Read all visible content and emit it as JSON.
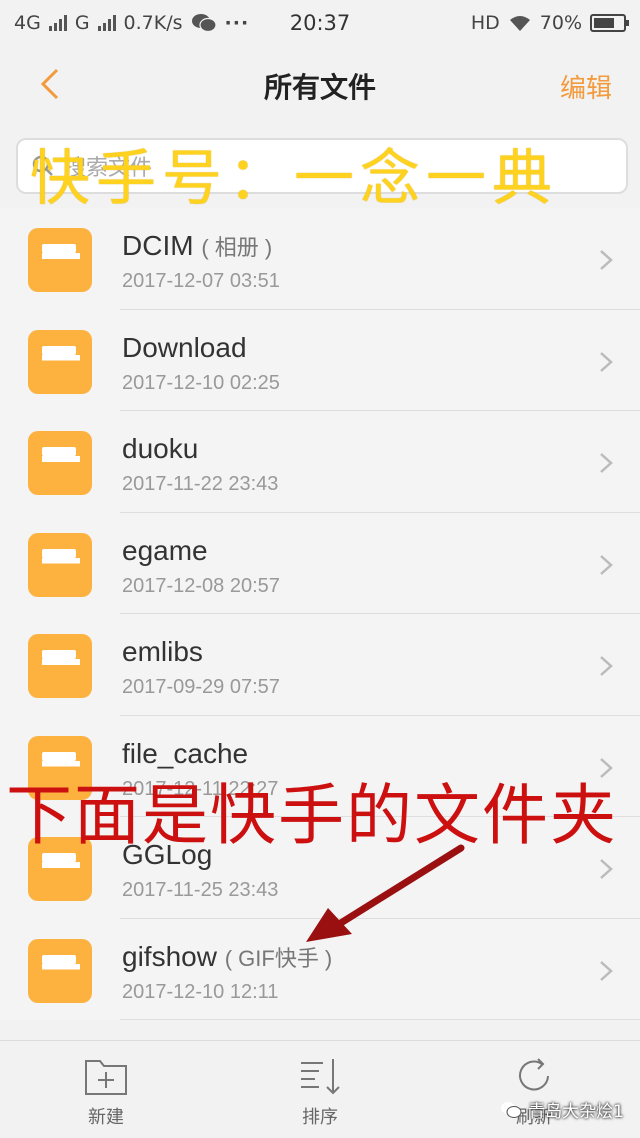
{
  "status_bar": {
    "network_1": "4G",
    "network_2": "G",
    "speed": "0.7K/s",
    "dots": "···",
    "time": "20:37",
    "hd": "HD",
    "battery": "70%",
    "battery_level_pct": 70
  },
  "nav": {
    "title": "所有文件",
    "edit_label": "编辑"
  },
  "search": {
    "placeholder": "搜索文件"
  },
  "overlays": {
    "top_text": "快手号：一念一典",
    "middle_text": "下面是快手的文件夹"
  },
  "files": [
    {
      "name": "DCIM",
      "note": "( 相册 )",
      "date": "2017-12-07 03:51"
    },
    {
      "name": "Download",
      "note": "",
      "date": "2017-12-10 02:25"
    },
    {
      "name": "duoku",
      "note": "",
      "date": "2017-11-22 23:43"
    },
    {
      "name": "egame",
      "note": "",
      "date": "2017-12-08 20:57"
    },
    {
      "name": "emlibs",
      "note": "",
      "date": "2017-09-29 07:57"
    },
    {
      "name": "file_cache",
      "note": "",
      "date": "2017-12-11 22:27"
    },
    {
      "name": "GGLog",
      "note": "",
      "date": "2017-11-25 23:43"
    },
    {
      "name": "gifshow",
      "note": "( GIF快手 )",
      "date": "2017-12-10 12:11"
    }
  ],
  "toolbar": {
    "new_label": "新建",
    "sort_label": "排序",
    "refresh_label": "刷新"
  },
  "watermark": "青岛大杂烩1",
  "colors": {
    "accent": "#f39a3d",
    "folder": "#fdb13f",
    "overlay_yellow": "#ffd21f",
    "overlay_red": "#cc1010"
  }
}
